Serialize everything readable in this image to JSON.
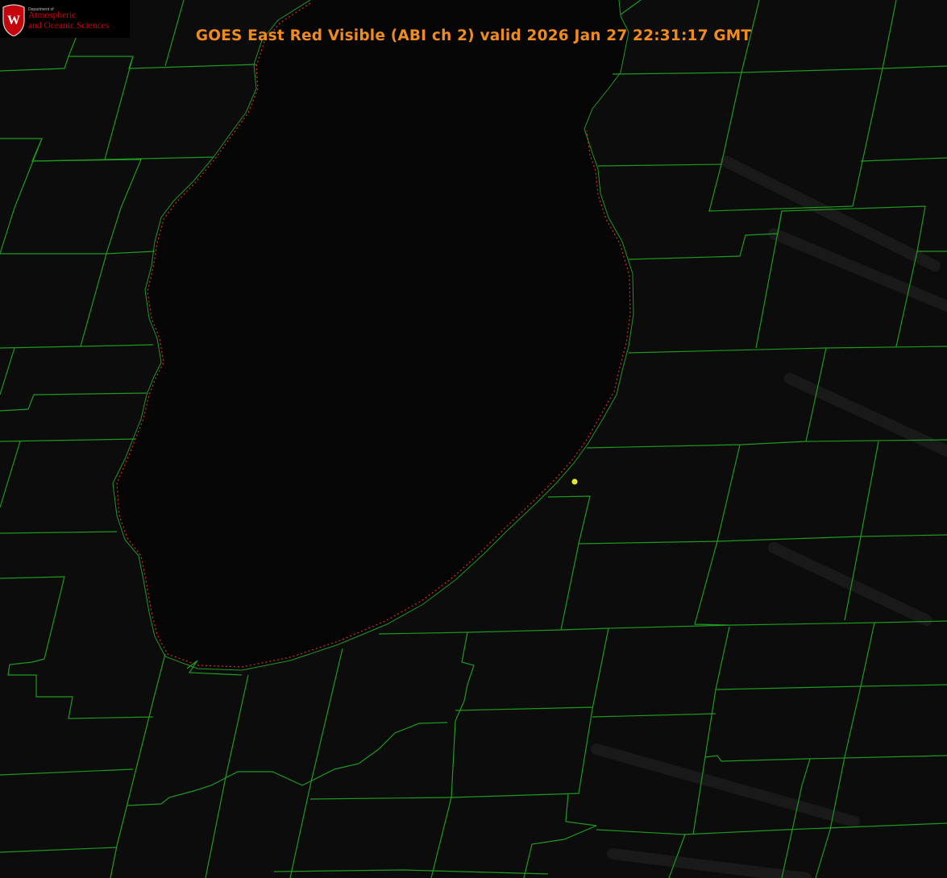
{
  "title": "GOES East Red Visible (ABI ch 2) valid 2026 Jan 27 22:31:17 GMT",
  "logo": {
    "department": "Department of",
    "line1": "Atmospheric",
    "line2": "and Oceanic Sciences",
    "crest_letter": "W"
  },
  "colors": {
    "title": "#f08c1e",
    "county_lines": "#1e9a1e",
    "state_border": "#dc2d2d",
    "station_marker": "#e6e632",
    "logo_text": "#c5050c",
    "lake": "#050505",
    "land": "#0c0c0c"
  }
}
